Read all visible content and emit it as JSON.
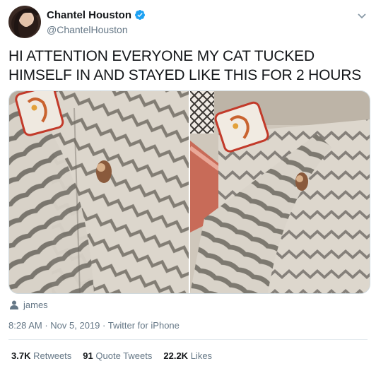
{
  "author": {
    "display_name": "Chantel Houston",
    "handle": "@ChantelHouston",
    "avatar_icon": "profile-photo",
    "verified_icon": "verified-badge-icon",
    "verified_color": "#1da1f2"
  },
  "tweet": {
    "text": "HI ATTENTION EVERYONE MY CAT TUCKED HIMSELF IN AND STAYED LIKE THIS FOR 2 HOURS"
  },
  "media": {
    "photos": [
      {
        "alt_icon": "photo-cat-under-blanket-left"
      },
      {
        "alt_icon": "photo-cat-under-blanket-right"
      }
    ],
    "tagged_user": "james",
    "tag_icon": "person-icon"
  },
  "meta": {
    "time": "8:28 AM",
    "date": "Nov 5, 2019",
    "source": "Twitter for iPhone"
  },
  "stats": {
    "retweets_count": "3.7K",
    "retweets_label": "Retweets",
    "quotes_count": "91",
    "quotes_label": "Quote Tweets",
    "likes_count": "22.2K",
    "likes_label": "Likes"
  }
}
